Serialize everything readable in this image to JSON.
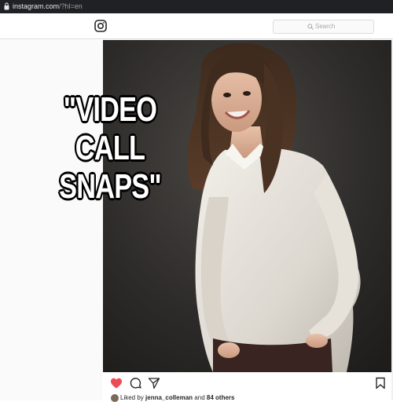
{
  "browser": {
    "url_host": "instagram.com",
    "url_path": "/?hl=en"
  },
  "header": {
    "logo_icon": "instagram-camera-icon",
    "search_placeholder": "Search"
  },
  "post": {
    "overlay_lines": [
      "\"VIDEO",
      "CALL",
      "SNAPS\""
    ],
    "liked_by_prefix": "Liked by",
    "liked_by_user": "jenna_colleman",
    "liked_by_middle": "and",
    "liked_by_count": "84 others",
    "like_color": "#ed4956",
    "icons": [
      "heart-icon",
      "comment-icon",
      "share-icon",
      "bookmark-icon"
    ]
  }
}
